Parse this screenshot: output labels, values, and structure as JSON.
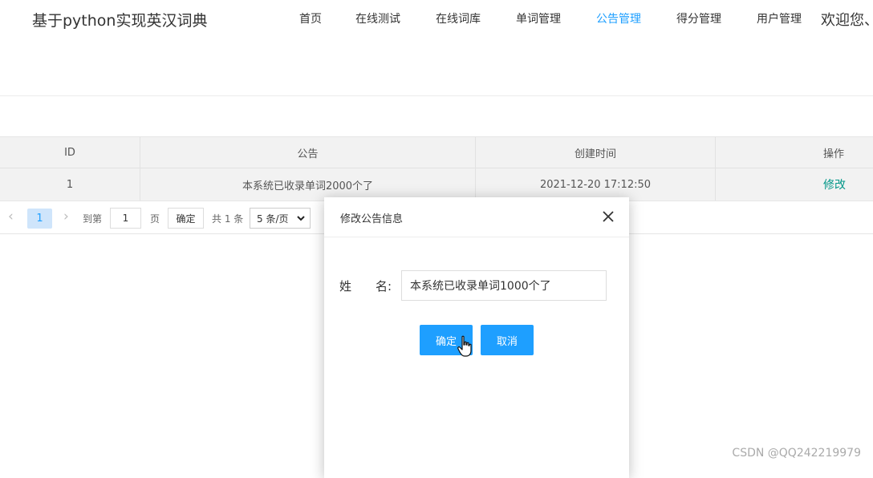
{
  "header": {
    "brand": "基于python实现英汉词典",
    "nav": [
      {
        "label": "首页",
        "active": false
      },
      {
        "label": "在线测试",
        "active": false
      },
      {
        "label": "在线词库",
        "active": false
      },
      {
        "label": "单词管理",
        "active": false
      },
      {
        "label": "公告管理",
        "active": true
      },
      {
        "label": "得分管理",
        "active": false
      },
      {
        "label": "用户管理",
        "active": false
      }
    ],
    "welcome": "欢迎您、"
  },
  "table": {
    "columns": [
      "ID",
      "公告",
      "创建时间",
      "操作"
    ],
    "rows": [
      {
        "id": "1",
        "notice": "本系统已收录单词2000个了",
        "created": "2021-12-20 17:12:50",
        "action": "修改"
      }
    ]
  },
  "pager": {
    "prev": "‹",
    "current_page": "1",
    "next": "›",
    "goto_label": "到第",
    "goto_value": "1",
    "page_unit": "页",
    "confirm": "确定",
    "total": "共 1 条",
    "page_size": "5 条/页"
  },
  "modal": {
    "title": "修改公告信息",
    "field_label": "姓　　名:",
    "field_value": "本系统已收录单词1000个了",
    "confirm": "确定",
    "cancel": "取消"
  },
  "watermark": "CSDN @QQ242219979",
  "colors": {
    "accent": "#1e9fff",
    "link": "#009688",
    "table_bg": "#f2f2f2"
  }
}
